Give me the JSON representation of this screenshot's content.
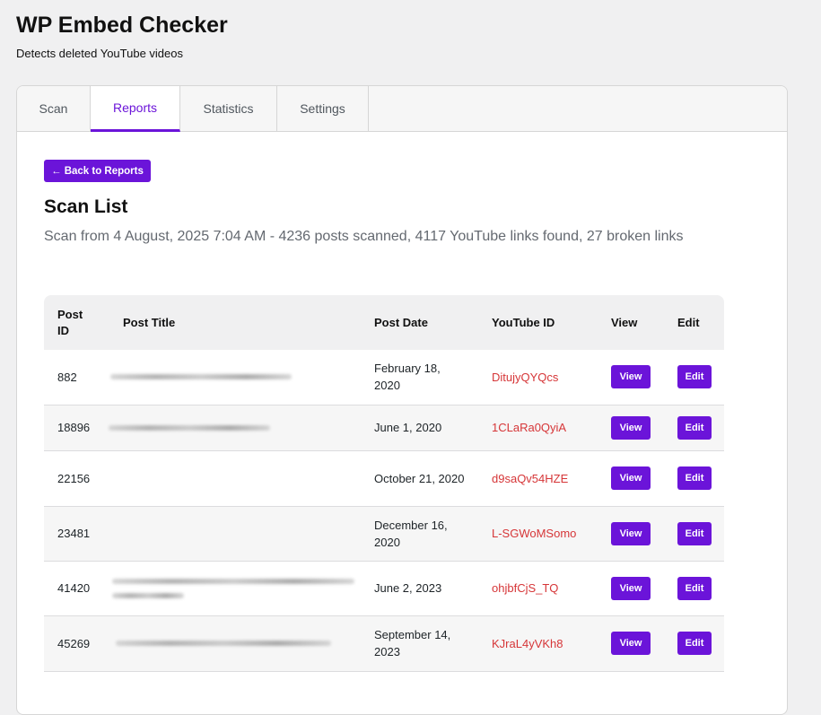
{
  "app": {
    "title": "WP Embed Checker",
    "subtitle": "Detects deleted YouTube videos"
  },
  "tabs": [
    {
      "label": "Scan",
      "active": false
    },
    {
      "label": "Reports",
      "active": true
    },
    {
      "label": "Statistics",
      "active": false
    },
    {
      "label": "Settings",
      "active": false
    }
  ],
  "report": {
    "back_label": "← Back to Reports",
    "title": "Scan List",
    "summary": "Scan from 4 August, 2025 7:04 AM - 4236 posts scanned, 4117 YouTube links found, 27 broken links"
  },
  "table": {
    "columns": {
      "post_id": "Post ID",
      "post_title": "Post Title",
      "post_date": "Post Date",
      "youtube_id": "YouTube ID",
      "view": "View",
      "edit": "Edit"
    },
    "rows": [
      {
        "post_id": "882",
        "post_date": "February 18, 2020",
        "youtube_id": "DitujyQYQcs",
        "view": "View",
        "edit": "Edit",
        "title_redacted": true
      },
      {
        "post_id": "18896",
        "post_date": "June 1, 2020",
        "youtube_id": "1CLaRa0QyiA",
        "view": "View",
        "edit": "Edit",
        "title_redacted": true
      },
      {
        "post_id": "22156",
        "post_date": "October 21, 2020",
        "youtube_id": "d9saQv54HZE",
        "view": "View",
        "edit": "Edit",
        "title_redacted": false
      },
      {
        "post_id": "23481",
        "post_date": "December 16, 2020",
        "youtube_id": "L-SGWoMSomo",
        "view": "View",
        "edit": "Edit",
        "title_redacted": false
      },
      {
        "post_id": "41420",
        "post_date": "June 2, 2023",
        "youtube_id": "ohjbfCjS_TQ",
        "view": "View",
        "edit": "Edit",
        "title_redacted": true
      },
      {
        "post_id": "45269",
        "post_date": "September 14, 2023",
        "youtube_id": "KJraL4yVKh8",
        "view": "View",
        "edit": "Edit",
        "title_redacted": true
      }
    ]
  },
  "colors": {
    "accent": "#6b14d9",
    "youtube_id": "#d63638"
  }
}
